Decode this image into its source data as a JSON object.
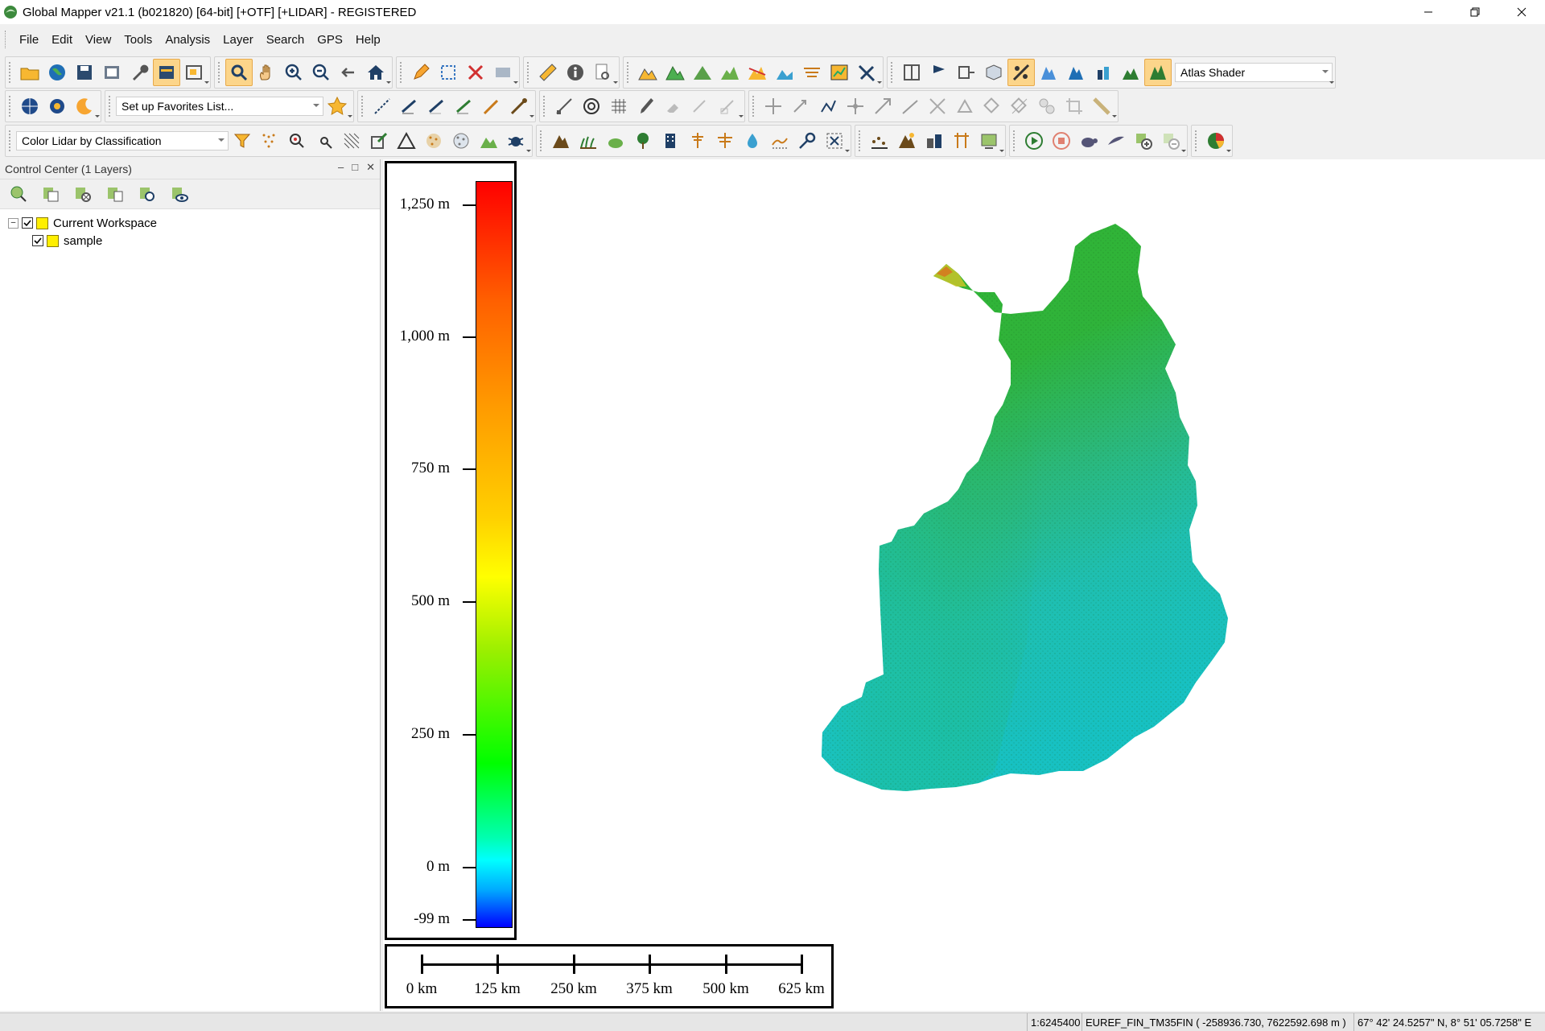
{
  "window": {
    "title": "Global Mapper v21.1 (b021820) [64-bit] [+OTF] [+LIDAR] - REGISTERED",
    "icons": [
      "minimize-icon",
      "restore-icon",
      "close-icon"
    ]
  },
  "menu": [
    "File",
    "Edit",
    "View",
    "Tools",
    "Analysis",
    "Layer",
    "Search",
    "GPS",
    "Help"
  ],
  "toolbar": {
    "shader_select": "Atlas Shader",
    "favorites_select": "Set up Favorites List...",
    "lidar_select": "Color Lidar by Classification"
  },
  "control_center": {
    "title": "Control Center (1 Layers)",
    "ctrl_icons": [
      "pin-icon",
      "float-icon",
      "close-icon"
    ],
    "tree": [
      {
        "label": "Current Workspace",
        "checked": true,
        "expanded": true
      },
      {
        "label": "sample",
        "checked": true
      }
    ]
  },
  "legend": {
    "labels": [
      "1,250 m",
      "1,000 m",
      "750 m",
      "500 m",
      "250 m",
      "0 m",
      "-99 m"
    ],
    "values": [
      1250,
      1000,
      750,
      500,
      250,
      0,
      -99
    ],
    "colors": [
      "#ff0000",
      "#ff9a00",
      "#ffff00",
      "#00ff00",
      "#00ffff",
      "#0000ff"
    ]
  },
  "scale_bar": {
    "labels": [
      "0 km",
      "125 km",
      "250 km",
      "375 km",
      "500 km",
      "625 km"
    ]
  },
  "status": {
    "scale": "1:6245400",
    "projection": "EUREF_FIN_TM35FIN ( -258936.730, 7622592.698 m )",
    "coords": "67° 42' 24.5257\" N, 8° 51' 05.7258\" E"
  }
}
